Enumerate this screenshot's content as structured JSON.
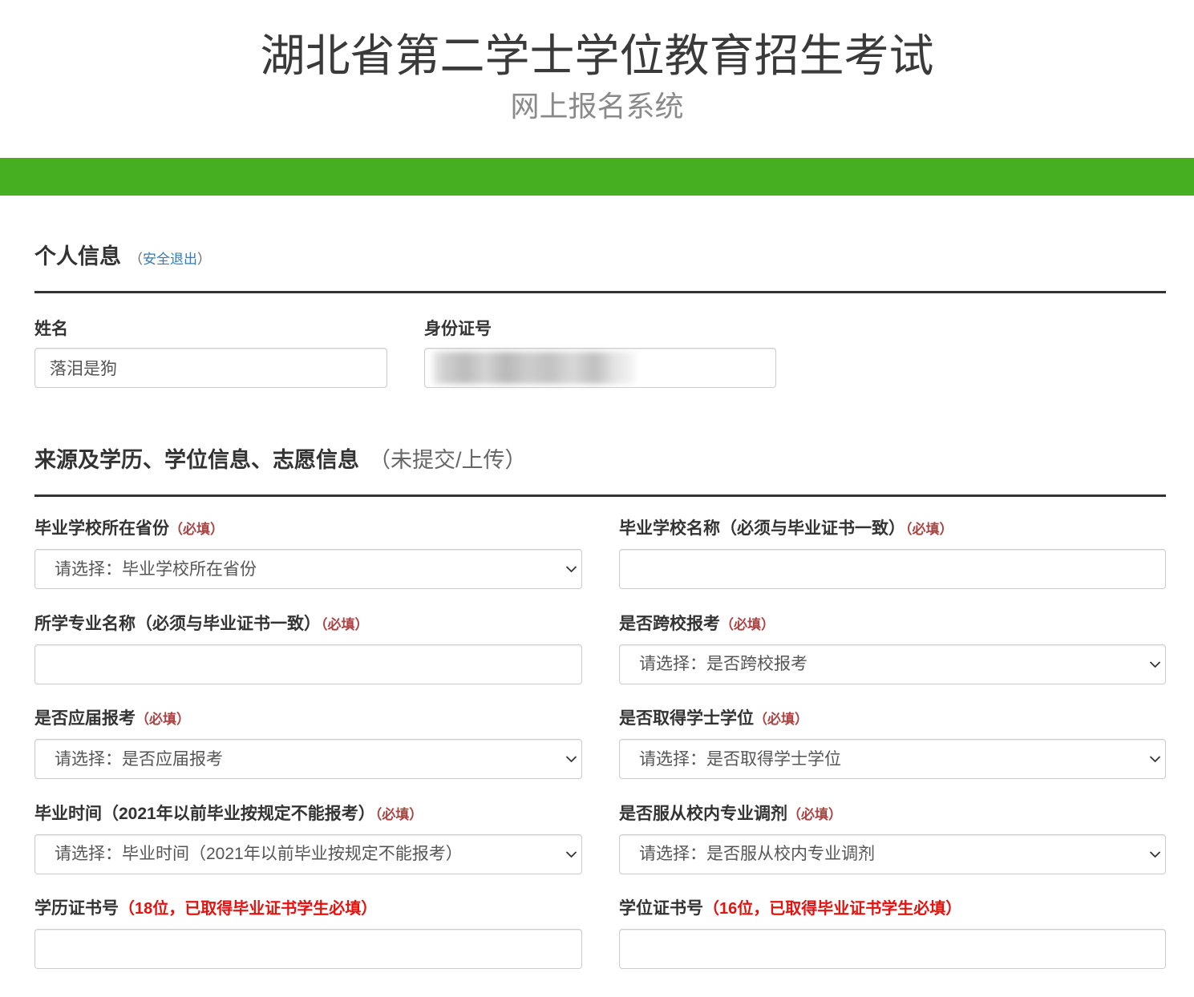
{
  "header": {
    "title": "湖北省第二学士学位教育招生考试",
    "subtitle": "网上报名系统"
  },
  "personal": {
    "heading": "个人信息",
    "logout": {
      "open": "（",
      "label": "安全退出",
      "close": "）"
    },
    "name": {
      "label": "姓名",
      "value": "落泪是狗"
    },
    "id_number": {
      "label": "身份证号"
    }
  },
  "education": {
    "heading": "来源及学历、学位信息、志愿信息",
    "status": "（未提交/上传）",
    "fields": [
      {
        "label": "毕业学校所在省份",
        "note": "（必填）",
        "selected": "请选择：毕业学校所在省份",
        "icon": "chevron-down-icon"
      },
      {
        "label": "毕业学校名称（必须与毕业证书一致）",
        "note": "（必填）"
      },
      {
        "label": "所学专业名称（必须与毕业证书一致）",
        "note": "（必填）"
      },
      {
        "label": "是否跨校报考",
        "note": "（必填）",
        "selected": "请选择：是否跨校报考",
        "icon": "chevron-down-icon"
      },
      {
        "label": "是否应届报考",
        "note": "（必填）",
        "selected": "请选择：是否应届报考",
        "icon": "chevron-down-icon"
      },
      {
        "label": "是否取得学士学位",
        "note": "（必填）",
        "selected": "请选择：是否取得学士学位",
        "icon": "chevron-down-icon"
      },
      {
        "label": "毕业时间（2021年以前毕业按规定不能报考）",
        "note": "（必填）",
        "selected": "请选择：毕业时间（2021年以前毕业按规定不能报考）",
        "icon": "chevron-down-icon"
      },
      {
        "label": "是否服从校内专业调剂",
        "note": "（必填）",
        "selected": "请选择：是否服从校内专业调剂",
        "icon": "chevron-down-icon"
      },
      {
        "label": "学历证书号",
        "note": "（18位，已取得毕业证书学生必填）"
      },
      {
        "label": "学位证书号",
        "note": "（16位，已取得毕业证书学生必填）"
      }
    ]
  },
  "colors": {
    "banner_green": "#46ae21",
    "required_note": "#a94442",
    "hint_note": "#e4120f",
    "link": "#337ab7"
  }
}
